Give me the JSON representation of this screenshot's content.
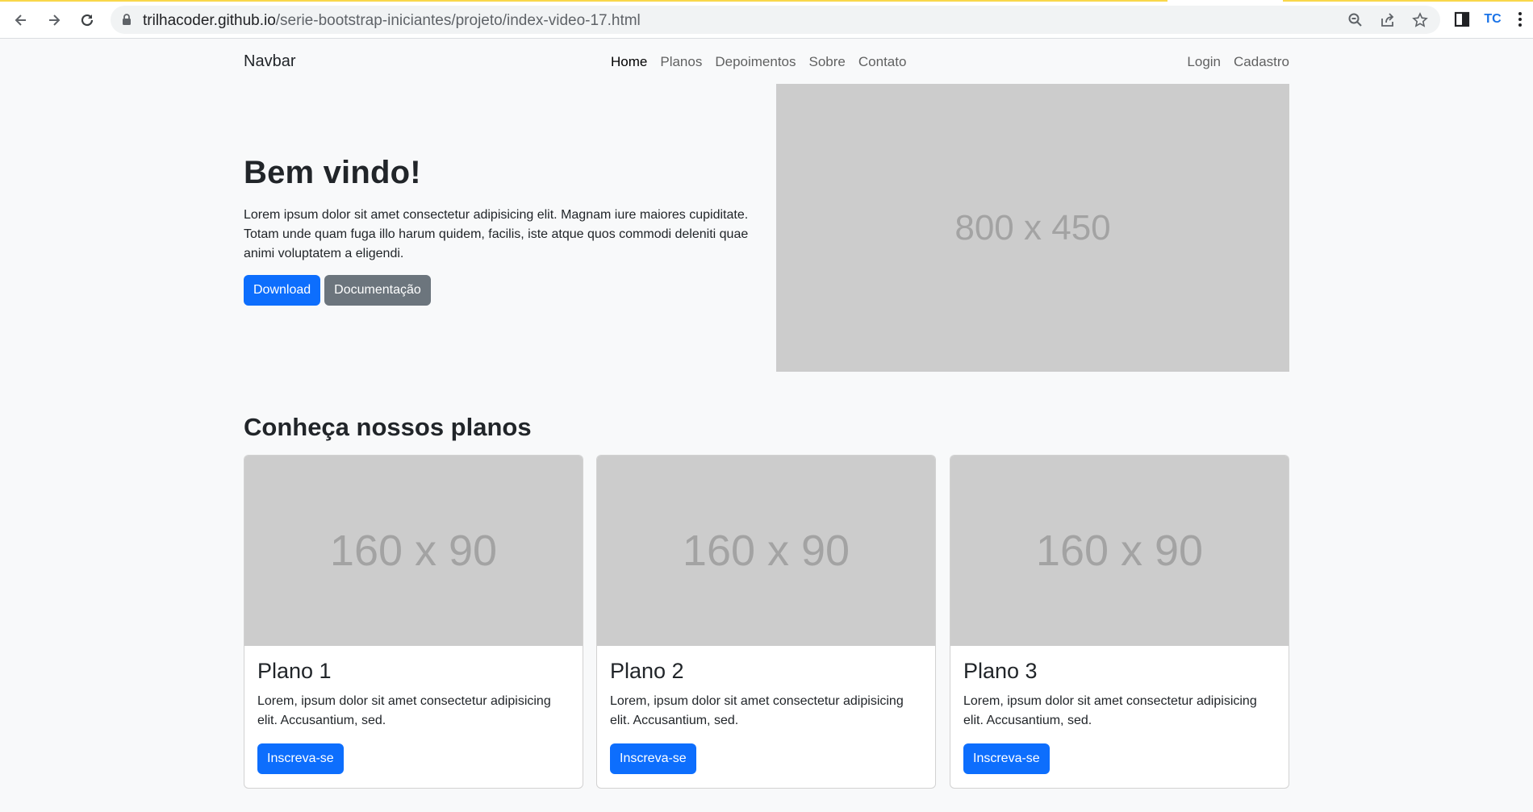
{
  "browser": {
    "url_host": "trilhacoder.github.io",
    "url_path": "/serie-bootstrap-iniciantes/projeto/index-video-17.html",
    "back_icon": "arrow-left-icon",
    "forward_icon": "arrow-right-icon",
    "reload_icon": "reload-icon",
    "lock_icon": "lock-icon",
    "zoom_icon": "zoom-icon",
    "share_icon": "share-icon",
    "bookmark_icon": "star-icon",
    "sidepanel_icon": "side-panel-icon",
    "extension_label": "TC",
    "menu_icon": "more-vertical-icon"
  },
  "navbar": {
    "brand": "Navbar",
    "links": [
      "Home",
      "Planos",
      "Depoimentos",
      "Sobre",
      "Contato"
    ],
    "active": "Home",
    "auth": [
      "Login",
      "Cadastro"
    ]
  },
  "hero": {
    "title": "Bem vindo!",
    "lead": "Lorem ipsum dolor sit amet consectetur adipisicing elit. Magnam iure maiores cupiditate. Totam unde quam fuga illo harum quidem, facilis, iste atque quos commodi deleniti quae animi voluptatem a eligendi.",
    "primary_button": "Download",
    "secondary_button": "Documentação",
    "image_label": "800 x 450"
  },
  "plans": {
    "title": "Conheça nossos planos",
    "cards": [
      {
        "image_label": "160 x 90",
        "title": "Plano 1",
        "text": "Lorem, ipsum dolor sit amet consectetur adipisicing elit. Accusantium, sed.",
        "button": "Inscreva-se"
      },
      {
        "image_label": "160 x 90",
        "title": "Plano 2",
        "text": "Lorem, ipsum dolor sit amet consectetur adipisicing elit. Accusantium, sed.",
        "button": "Inscreva-se"
      },
      {
        "image_label": "160 x 90",
        "title": "Plano 3",
        "text": "Lorem, ipsum dolor sit amet consectetur adipisicing elit. Accusantium, sed.",
        "button": "Inscreva-se"
      }
    ]
  },
  "colors": {
    "primary": "#0d6efd",
    "secondary": "#6c757d",
    "placeholder_bg": "#cccccc",
    "placeholder_text": "#a3a3a3",
    "page_bg": "#f8f9fa"
  }
}
